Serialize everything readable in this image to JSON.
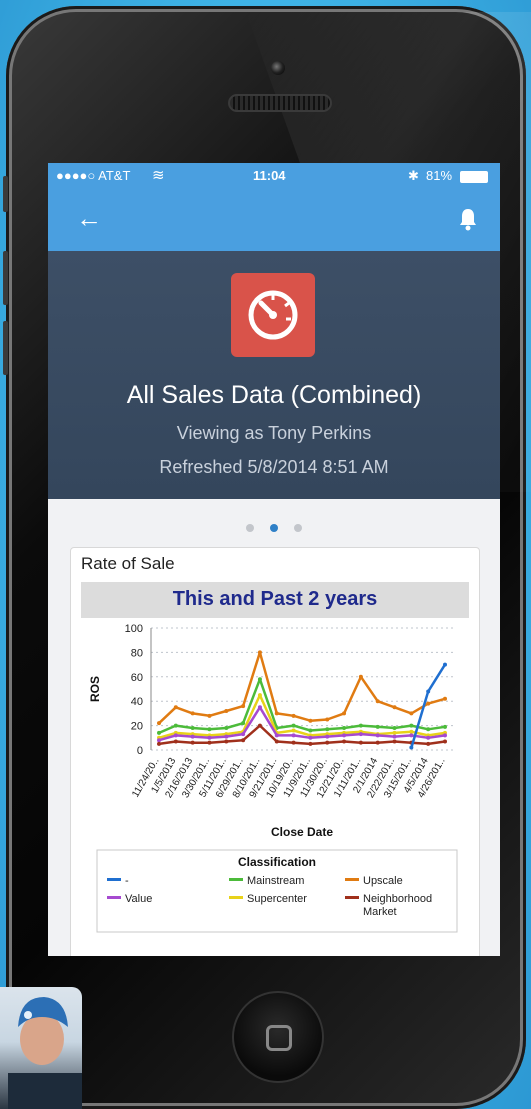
{
  "status": {
    "carrier": "●●●●○ AT&T",
    "time": "11:04",
    "battery": "81%"
  },
  "nav": {
    "back_icon": "back-arrow-icon",
    "bell_icon": "bell-icon"
  },
  "hero": {
    "icon": "speedometer-icon",
    "title": "All Sales Data (Combined)",
    "viewing_as": "Viewing as Tony Perkins",
    "refreshed": "Refreshed 5/8/2014 8:51 AM"
  },
  "pager": {
    "count": 3,
    "active": 2
  },
  "card": {
    "title": "Rate of Sale"
  },
  "chart_data": {
    "type": "line",
    "title": "This and Past 2 years",
    "xlabel": "Close Date",
    "ylabel": "ROS",
    "ylim": [
      0,
      100
    ],
    "yticks": [
      0,
      20,
      40,
      60,
      80,
      100
    ],
    "grid": true,
    "categories": [
      "11/24/20..",
      "1/5/2013",
      "2/16/2013",
      "3/30/201..",
      "5/11/201..",
      "6/29/201..",
      "8/10/201..",
      "9/21/201..",
      "10/19/20..",
      "11/9/201..",
      "11/30/20..",
      "12/21/20..",
      "1/11/201..",
      "2/1/2014",
      "2/22/201..",
      "3/15/201..",
      "4/5/2014",
      "4/26/201.."
    ],
    "legend": {
      "title": "Classification",
      "entries": [
        {
          "name": "-",
          "color": "#1f6fd0"
        },
        {
          "name": "Mainstream",
          "color": "#4cbb3a"
        },
        {
          "name": "Upscale",
          "color": "#e07b12"
        },
        {
          "name": "Value",
          "color": "#a64ad0"
        },
        {
          "name": "Supercenter",
          "color": "#e8d21a"
        },
        {
          "name": "Neighborhood Market",
          "color": "#a0301c"
        }
      ]
    },
    "series": [
      {
        "name": "Upscale",
        "color": "#e07b12",
        "values": [
          22,
          35,
          30,
          28,
          32,
          36,
          80,
          30,
          28,
          24,
          25,
          30,
          60,
          40,
          35,
          30,
          38,
          42
        ]
      },
      {
        "name": "Mainstream",
        "color": "#4cbb3a",
        "values": [
          14,
          20,
          18,
          17,
          18,
          22,
          58,
          18,
          20,
          16,
          17,
          18,
          20,
          19,
          18,
          20,
          17,
          19
        ]
      },
      {
        "name": "Supercenter",
        "color": "#e8d21a",
        "values": [
          10,
          14,
          13,
          12,
          13,
          15,
          45,
          14,
          16,
          12,
          13,
          14,
          15,
          13,
          14,
          15,
          12,
          14
        ]
      },
      {
        "name": "Value",
        "color": "#a64ad0",
        "values": [
          8,
          12,
          11,
          10,
          11,
          13,
          35,
          12,
          12,
          10,
          11,
          12,
          13,
          12,
          11,
          12,
          10,
          12
        ]
      },
      {
        "name": "Neighborhood Market",
        "color": "#a0301c",
        "values": [
          5,
          7,
          6,
          6,
          7,
          8,
          20,
          7,
          6,
          5,
          6,
          7,
          6,
          6,
          7,
          6,
          5,
          7
        ]
      },
      {
        "name": "-",
        "color": "#1f6fd0",
        "values": [
          null,
          null,
          null,
          null,
          null,
          null,
          null,
          null,
          null,
          null,
          null,
          null,
          null,
          null,
          null,
          2,
          48,
          70
        ]
      }
    ]
  }
}
